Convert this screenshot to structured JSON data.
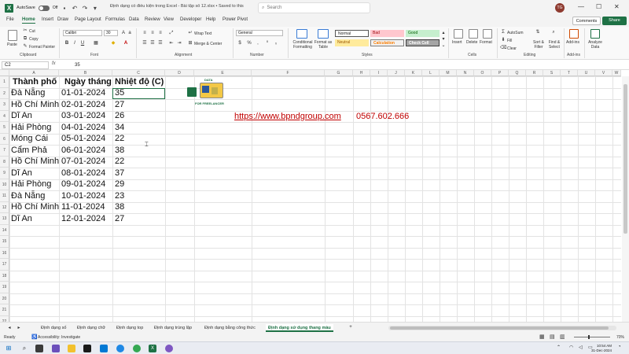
{
  "titlebar": {
    "autosave_label": "AutoSave",
    "autosave_state": "Off",
    "doc_title": "Định dạng có điều kiện trong Excel - Bài tập số 12.xlsx • Saved to this PC",
    "search_placeholder": "Search",
    "avatar_initials": "TG"
  },
  "ribbon_tabs": [
    "File",
    "Home",
    "Insert",
    "Draw",
    "Page Layout",
    "Formulas",
    "Data",
    "Review",
    "View",
    "Developer",
    "Help",
    "Power Pivot"
  ],
  "ribbon_tab_active": "Home",
  "buttons": {
    "comments": "Comments",
    "share": "Share"
  },
  "ribbon": {
    "clipboard": {
      "paste": "Paste",
      "cut": "Cut",
      "copy": "Copy",
      "format_painter": "Format Painter",
      "label": "Clipboard"
    },
    "font": {
      "name": "Calibri",
      "size": "30",
      "label": "Font"
    },
    "alignment": {
      "wrap": "Wrap Text",
      "merge": "Merge & Center",
      "label": "Alignment"
    },
    "number": {
      "format": "General",
      "label": "Number"
    },
    "styles": {
      "conditional": "Conditional Formatting",
      "format_table": "Format as Table",
      "cells": [
        "Normal",
        "Bad",
        "Good",
        "Neutral",
        "Calculation",
        "Check Cell"
      ],
      "label": "Styles"
    },
    "cells": {
      "insert": "Insert",
      "delete": "Delete",
      "format": "Format",
      "label": "Cells"
    },
    "editing": {
      "autosum": "AutoSum",
      "fill": "Fill",
      "clear": "Clear",
      "sort": "Sort & Filter",
      "find": "Find & Select",
      "label": "Editing"
    },
    "addins": {
      "addins": "Add-ins",
      "label": "Add-ins",
      "analyze": "Analyze Data"
    }
  },
  "formula_bar": {
    "name_box": "C2",
    "fx": "fx",
    "value": "35"
  },
  "columns": [
    "A",
    "B",
    "C",
    "D",
    "E",
    "F",
    "G",
    "H",
    "I",
    "J",
    "K",
    "L",
    "M",
    "N",
    "O",
    "P",
    "Q",
    "R",
    "S",
    "T",
    "U",
    "V",
    "W",
    "X",
    "Y",
    "Z",
    "AA"
  ],
  "rows": [
    "1",
    "2",
    "3",
    "4",
    "5",
    "6",
    "7",
    "8",
    "9",
    "10",
    "11",
    "12",
    "13",
    "14",
    "15",
    "16",
    "17",
    "18",
    "19",
    "20",
    "21",
    "22",
    "23",
    "24",
    "25",
    "26",
    "27"
  ],
  "table": {
    "headers": [
      "Thành phố",
      "Ngày tháng",
      "Nhiệt độ (C)"
    ],
    "rows": [
      [
        "Đà Nẵng",
        "01-01-2024",
        "35"
      ],
      [
        "Hồ Chí Minh",
        "02-01-2024",
        "27"
      ],
      [
        "Dĩ An",
        "03-01-2024",
        "26"
      ],
      [
        "Hải Phòng",
        "04-01-2024",
        "34"
      ],
      [
        "Móng Cái",
        "05-01-2024",
        "22"
      ],
      [
        "Cẩm Phả",
        "06-01-2024",
        "38"
      ],
      [
        "Hồ Chí Minh",
        "07-01-2024",
        "22"
      ],
      [
        "Dĩ An",
        "08-01-2024",
        "37"
      ],
      [
        "Hải Phòng",
        "09-01-2024",
        "29"
      ],
      [
        "Đà Nẵng",
        "10-01-2024",
        "23"
      ],
      [
        "Hồ Chí Minh",
        "11-01-2024",
        "38"
      ],
      [
        "Dĩ An",
        "12-01-2024",
        "27"
      ]
    ]
  },
  "promo": {
    "link": "https://www.bpndgroup.com",
    "phone": "0567.602.666",
    "logo_top": "DATA",
    "logo_bottom": "FOR FREELANCER"
  },
  "sheet_tabs": [
    "Định dạng số",
    "Định dạng chữ",
    "Định dạng top",
    "Định dạng trùng lặp",
    "Định dạng bằng công thức",
    "Định dạng sử dụng thang màu"
  ],
  "sheet_tab_active": 5,
  "status": {
    "ready": "Ready",
    "accessibility": "Accessibility: Investigate",
    "zoom": "70%"
  },
  "clock": {
    "time": "10:54 AM",
    "date": "31-Dec-2024"
  },
  "colors": {
    "excel_green": "#1e7145",
    "link_red": "#c00000"
  }
}
